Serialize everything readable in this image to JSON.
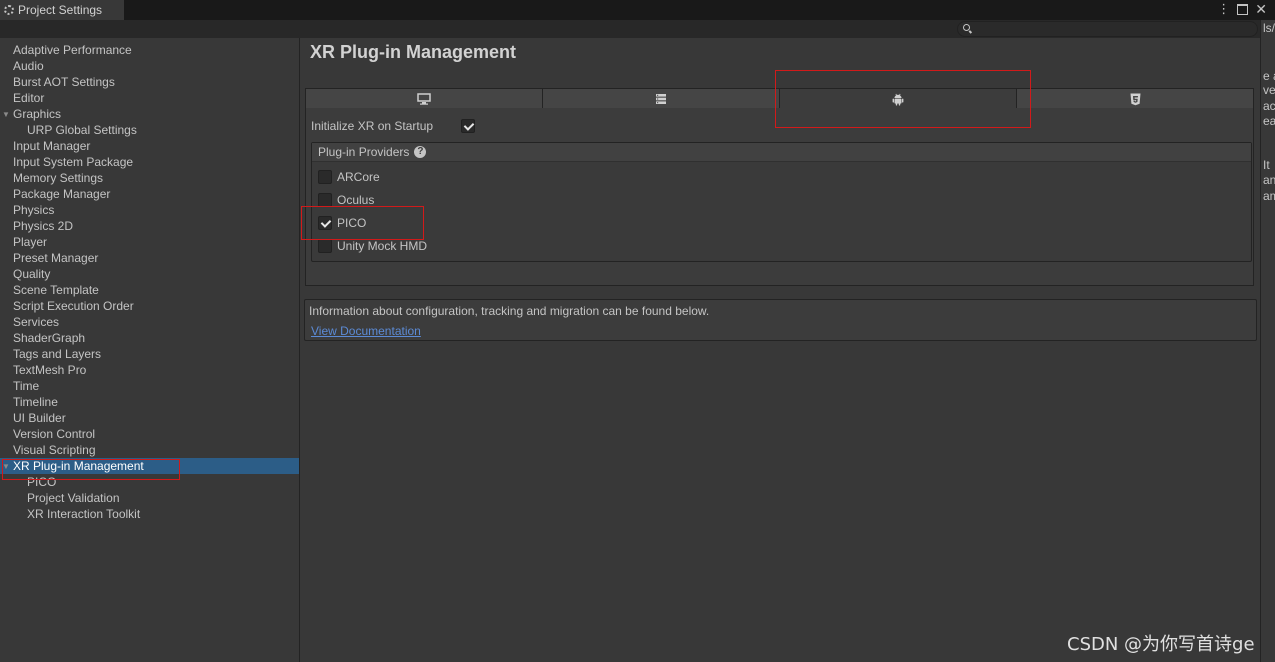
{
  "window": {
    "title": "Project Settings"
  },
  "right_strip_fragments": [
    "ls/",
    "e a",
    "ver",
    "ac",
    "ea",
    "It",
    "and",
    "am"
  ],
  "sidebar": {
    "items": [
      {
        "label": "Adaptive Performance"
      },
      {
        "label": "Audio"
      },
      {
        "label": "Burst AOT Settings"
      },
      {
        "label": "Editor"
      },
      {
        "label": "Graphics"
      },
      {
        "label": "URP Global Settings"
      },
      {
        "label": "Input Manager"
      },
      {
        "label": "Input System Package"
      },
      {
        "label": "Memory Settings"
      },
      {
        "label": "Package Manager"
      },
      {
        "label": "Physics"
      },
      {
        "label": "Physics 2D"
      },
      {
        "label": "Player"
      },
      {
        "label": "Preset Manager"
      },
      {
        "label": "Quality"
      },
      {
        "label": "Scene Template"
      },
      {
        "label": "Script Execution Order"
      },
      {
        "label": "Services"
      },
      {
        "label": "ShaderGraph"
      },
      {
        "label": "Tags and Layers"
      },
      {
        "label": "TextMesh Pro"
      },
      {
        "label": "Time"
      },
      {
        "label": "Timeline"
      },
      {
        "label": "UI Builder"
      },
      {
        "label": "Version Control"
      },
      {
        "label": "Visual Scripting"
      },
      {
        "label": "XR Plug-in Management"
      },
      {
        "label": "PICO"
      },
      {
        "label": "Project Validation"
      },
      {
        "label": "XR Interaction Toolkit"
      }
    ]
  },
  "main": {
    "title": "XR Plug-in Management",
    "tabs": [
      {
        "icon": "desktop-icon"
      },
      {
        "icon": "server-icon"
      },
      {
        "icon": "android-icon",
        "active": true
      },
      {
        "icon": "html5-icon"
      }
    ],
    "init_label": "Initialize XR on Startup",
    "init_checked": true,
    "providers_header": "Plug-in Providers",
    "providers": [
      {
        "label": "ARCore",
        "checked": false
      },
      {
        "label": "Oculus",
        "checked": false
      },
      {
        "label": "PICO",
        "checked": true
      },
      {
        "label": "Unity Mock HMD",
        "checked": false
      }
    ],
    "info_text": "Information about configuration, tracking and migration can be found below.",
    "doc_link": "View Documentation"
  },
  "watermark": "CSDN @为你写首诗ge",
  "colors": {
    "selection": "#2c5d87",
    "link": "#5c8bd6",
    "annotation": "#d21a1a"
  }
}
